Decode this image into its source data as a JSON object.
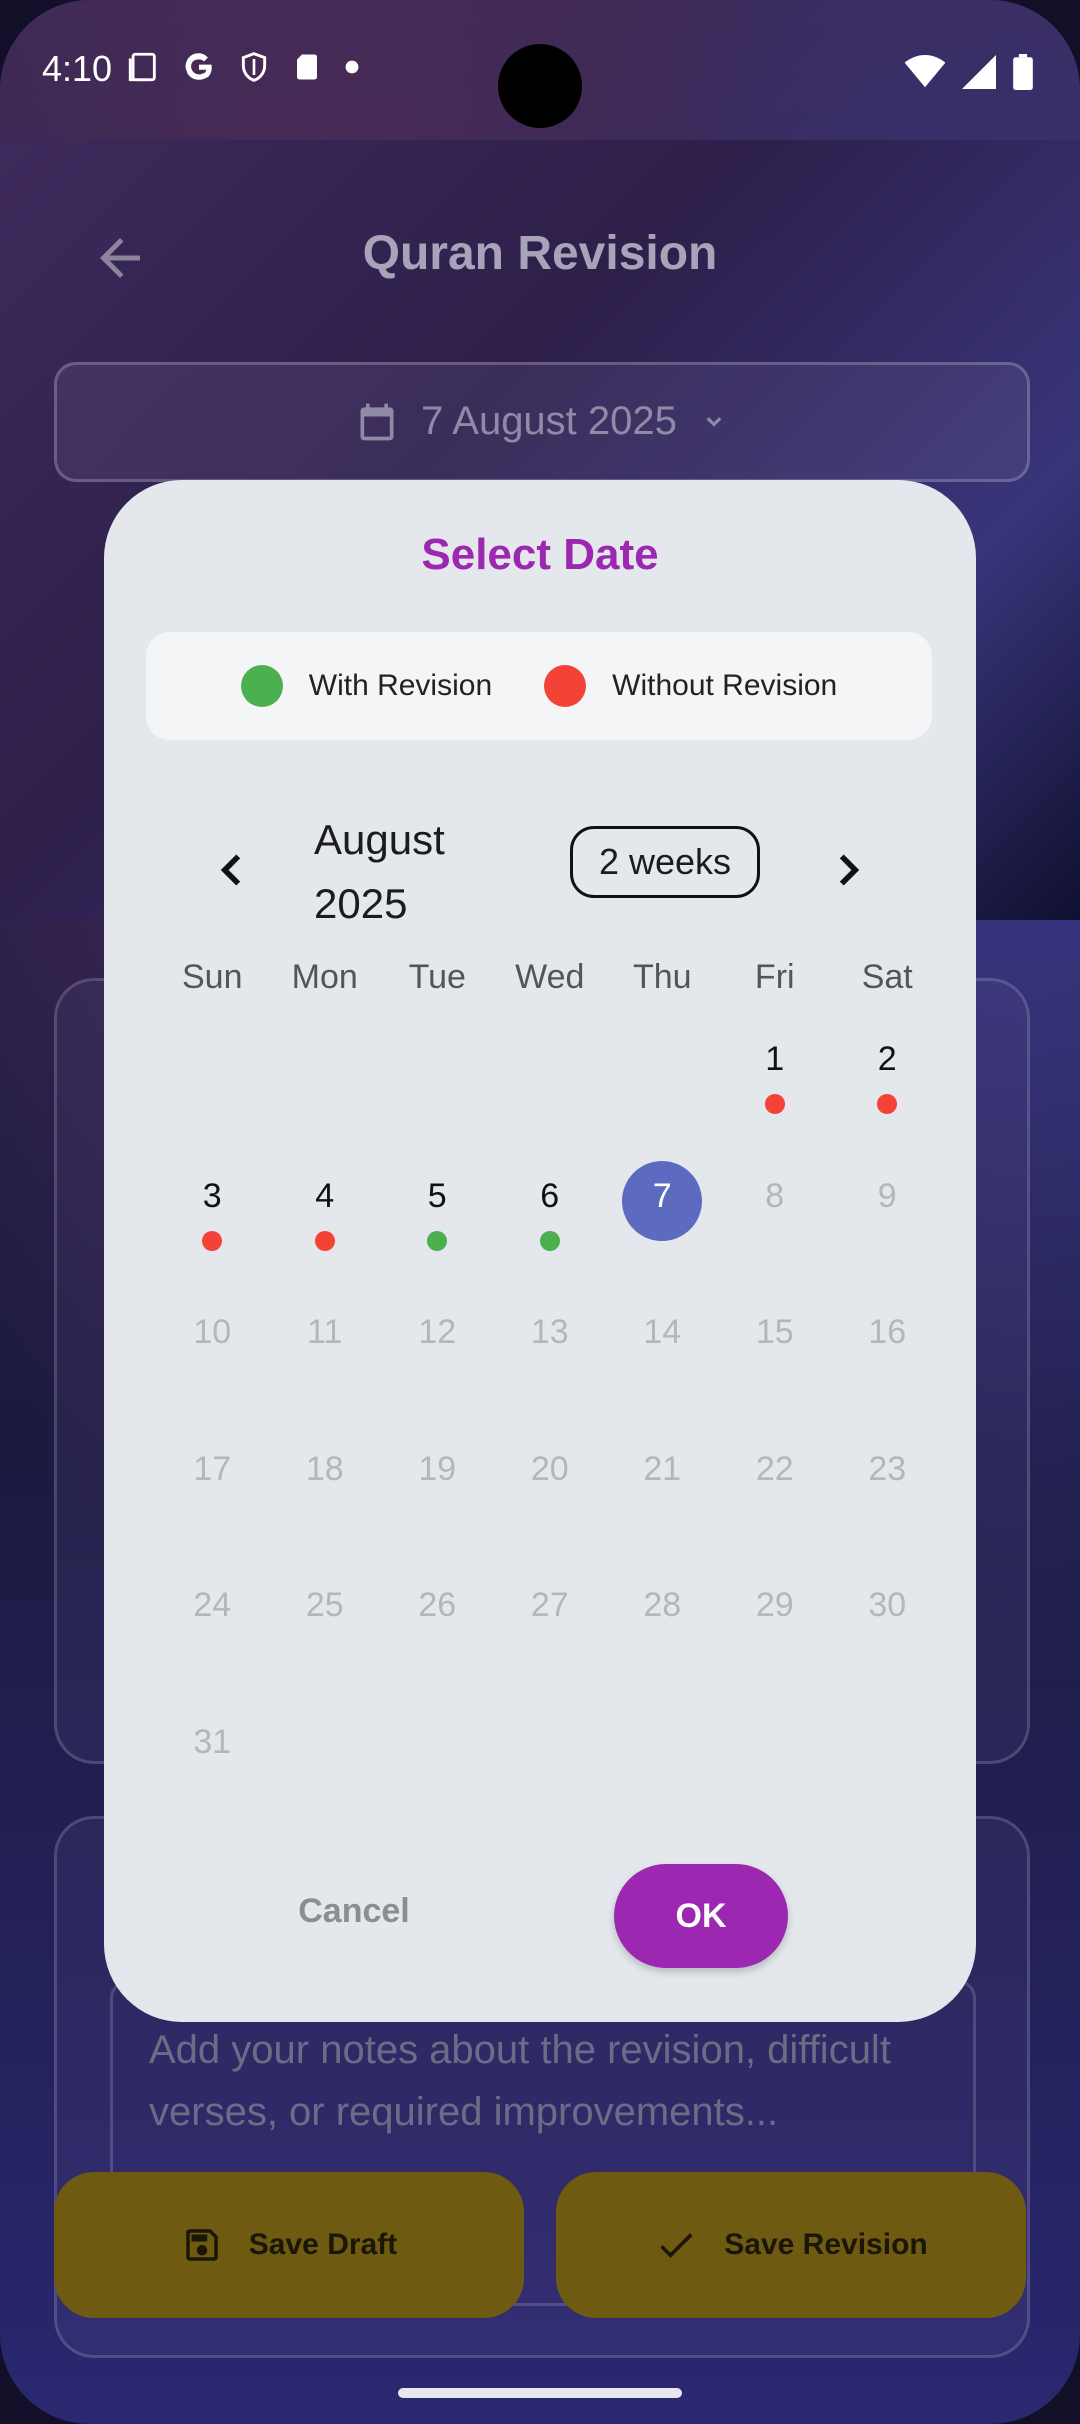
{
  "status_bar": {
    "time": "4:10",
    "icons_left": [
      "screenshot-icon",
      "google-icon",
      "shield-icon",
      "sd-card-icon",
      "dot-icon"
    ],
    "icons_right": [
      "wifi-icon",
      "signal-icon",
      "battery-icon"
    ]
  },
  "app_bar": {
    "title": "Quran Revision",
    "back_icon": "arrow-back-icon"
  },
  "date_field": {
    "value": "7 August 2025",
    "icon": "calendar-icon"
  },
  "notes": {
    "placeholder": "Add your notes about the revision, difficult verses, or required improvements..."
  },
  "bottom_buttons": {
    "draft_label": "Save Draft",
    "save_label": "Save Revision"
  },
  "dialog": {
    "title": "Select Date",
    "legend": [
      {
        "label": "With Revision",
        "color": "#4caf50"
      },
      {
        "label": "Without Revision",
        "color": "#f44336"
      }
    ],
    "month_title": "August 2025",
    "format_button": "2 weeks",
    "weekdays": [
      "Sun",
      "Mon",
      "Tue",
      "Wed",
      "Thu",
      "Fri",
      "Sat"
    ],
    "leading_blanks": 5,
    "days": [
      {
        "n": "1",
        "state": "enabled",
        "marker": "without"
      },
      {
        "n": "2",
        "state": "enabled",
        "marker": "without"
      },
      {
        "n": "3",
        "state": "enabled",
        "marker": "without"
      },
      {
        "n": "4",
        "state": "enabled",
        "marker": "without"
      },
      {
        "n": "5",
        "state": "enabled",
        "marker": "with"
      },
      {
        "n": "6",
        "state": "enabled",
        "marker": "with"
      },
      {
        "n": "7",
        "state": "selected",
        "marker": ""
      },
      {
        "n": "8",
        "state": "disabled",
        "marker": ""
      },
      {
        "n": "9",
        "state": "disabled",
        "marker": ""
      },
      {
        "n": "10",
        "state": "disabled",
        "marker": ""
      },
      {
        "n": "11",
        "state": "disabled",
        "marker": ""
      },
      {
        "n": "12",
        "state": "disabled",
        "marker": ""
      },
      {
        "n": "13",
        "state": "disabled",
        "marker": ""
      },
      {
        "n": "14",
        "state": "disabled",
        "marker": ""
      },
      {
        "n": "15",
        "state": "disabled",
        "marker": ""
      },
      {
        "n": "16",
        "state": "disabled",
        "marker": ""
      },
      {
        "n": "17",
        "state": "disabled",
        "marker": ""
      },
      {
        "n": "18",
        "state": "disabled",
        "marker": ""
      },
      {
        "n": "19",
        "state": "disabled",
        "marker": ""
      },
      {
        "n": "20",
        "state": "disabled",
        "marker": ""
      },
      {
        "n": "21",
        "state": "disabled",
        "marker": ""
      },
      {
        "n": "22",
        "state": "disabled",
        "marker": ""
      },
      {
        "n": "23",
        "state": "disabled",
        "marker": ""
      },
      {
        "n": "24",
        "state": "disabled",
        "marker": ""
      },
      {
        "n": "25",
        "state": "disabled",
        "marker": ""
      },
      {
        "n": "26",
        "state": "disabled",
        "marker": ""
      },
      {
        "n": "27",
        "state": "disabled",
        "marker": ""
      },
      {
        "n": "28",
        "state": "disabled",
        "marker": ""
      },
      {
        "n": "29",
        "state": "disabled",
        "marker": ""
      },
      {
        "n": "30",
        "state": "disabled",
        "marker": ""
      },
      {
        "n": "31",
        "state": "disabled",
        "marker": ""
      }
    ],
    "cancel_label": "Cancel",
    "ok_label": "OK",
    "colors": {
      "accent": "#9c27b0",
      "selected": "#5c6bc0",
      "with_revision": "#4caf50",
      "without_revision": "#f44336"
    }
  }
}
